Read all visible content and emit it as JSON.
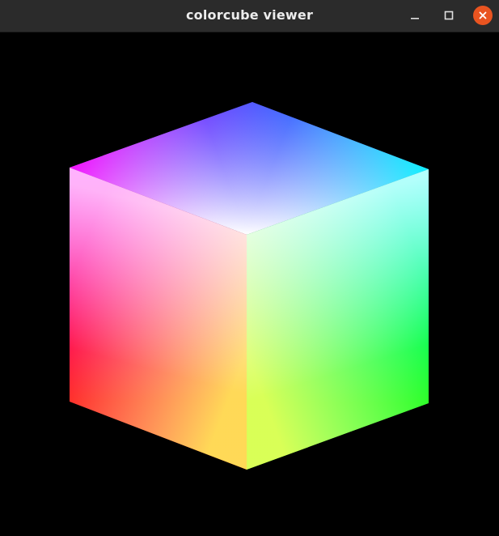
{
  "window": {
    "title": "colorcube viewer",
    "controls": {
      "minimize": "minimize-icon",
      "maximize": "maximize-icon",
      "close": "close-icon"
    },
    "accent_close": "#e95420",
    "titlebar_bg": "#2b2b2b"
  },
  "viewport": {
    "background": "#000000",
    "cube": {
      "corners": {
        "white": "#ffffff",
        "blue": "#0000ff",
        "magenta": "#ff00ff",
        "cyan": "#00ffff",
        "red": "#ff0000",
        "green": "#00ff00",
        "yellow": "#ffff00"
      }
    }
  }
}
